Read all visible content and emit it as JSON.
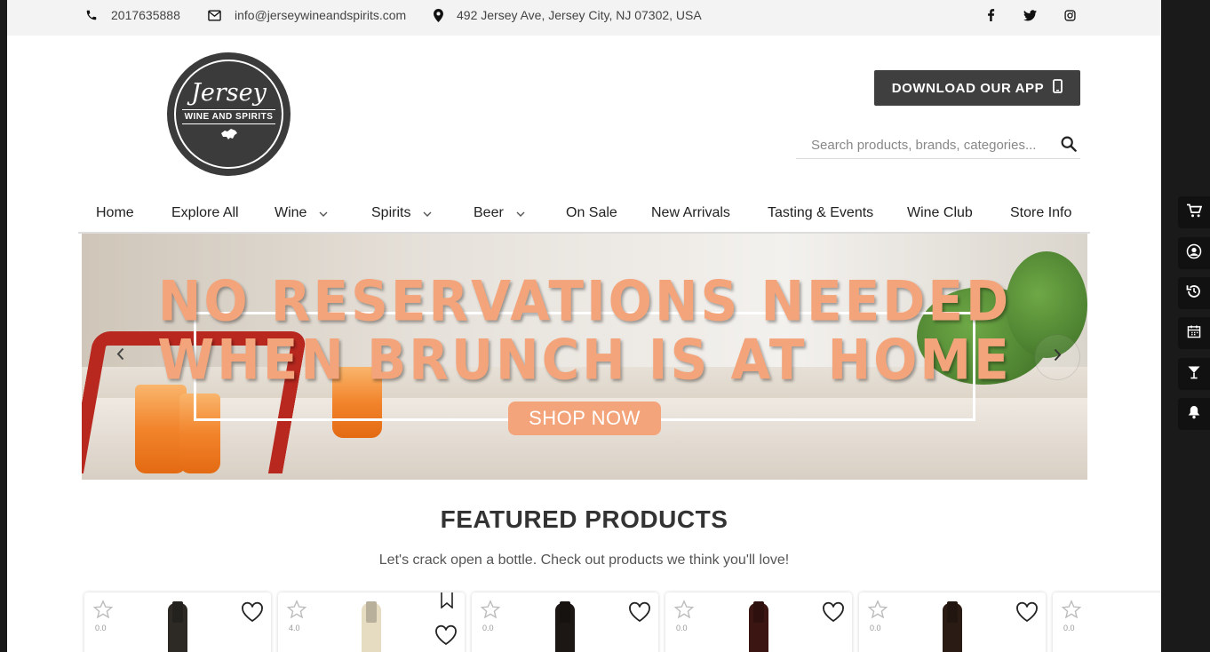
{
  "topbar": {
    "phone": "2017635888",
    "email": "info@jerseywineandspirits.com",
    "address": "492 Jersey Ave, Jersey City, NJ 07302, USA",
    "social": [
      "facebook-icon",
      "twitter-icon",
      "instagram-icon"
    ]
  },
  "logo": {
    "script": "Jersey",
    "sub": "WINE AND SPIRITS"
  },
  "header": {
    "download_label": "DOWNLOAD OUR APP",
    "search_placeholder": "Search products, brands, categories..."
  },
  "nav": {
    "items": [
      {
        "label": "Home"
      },
      {
        "label": "Explore All"
      },
      {
        "label": "Wine",
        "dropdown": true
      },
      {
        "label": "Spirits",
        "dropdown": true
      },
      {
        "label": "Beer",
        "dropdown": true
      },
      {
        "label": "On Sale"
      },
      {
        "label": "New Arrivals"
      },
      {
        "label": "Tasting & Events"
      },
      {
        "label": "Wine Club"
      },
      {
        "label": "Store Info"
      }
    ]
  },
  "hero": {
    "line1": "NO RESERVATIONS NEEDED",
    "line2": "WHEN BRUNCH IS AT HOME",
    "cta": "SHOP NOW"
  },
  "featured": {
    "title": "FEATURED PRODUCTS",
    "subtitle": "Let's crack open a bottle. Check out products we think you'll love!",
    "products": [
      {
        "rating": "0.0",
        "bottle_color": "#2d2a26"
      },
      {
        "rating": "4.0",
        "bottle_color": "#e6dcc2"
      },
      {
        "rating": "0.0",
        "bottle_color": "#1c1614"
      },
      {
        "rating": "0.0",
        "bottle_color": "#3a1512"
      },
      {
        "rating": "0.0",
        "bottle_color": "#2a1c14"
      },
      {
        "rating": "0.0",
        "bottle_color": "#ffffff"
      }
    ]
  },
  "side_toolbar": [
    "cart-icon",
    "account-icon",
    "history-icon",
    "calendar-icon",
    "cocktail-icon",
    "bell-icon"
  ],
  "colors": {
    "accent": "#f4a47a",
    "dark_button": "#3f3f3f",
    "topbar_bg": "#f3f3f3"
  }
}
